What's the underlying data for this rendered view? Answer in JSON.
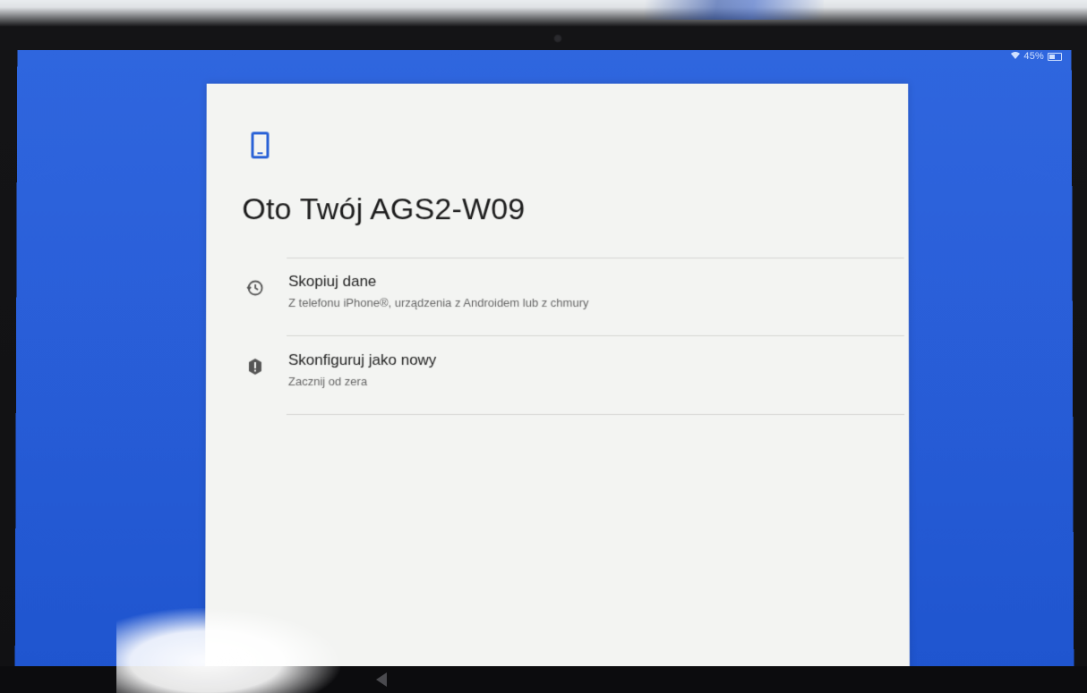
{
  "status_bar": {
    "battery_text": "45%",
    "wifi_icon": "wifi-icon",
    "battery_icon": "battery-icon"
  },
  "setup": {
    "device_icon": "phone-icon",
    "title": "Oto Twój AGS2-W09",
    "options": [
      {
        "icon": "history-icon",
        "label": "Skopiuj dane",
        "subtitle": "Z telefonu iPhone®, urządzenia z Androidem lub z chmury"
      },
      {
        "icon": "new-device-icon",
        "label": "Skonfiguruj jako nowy",
        "subtitle": "Zacznij od zera"
      }
    ]
  },
  "nav": {
    "back_icon": "back-icon"
  },
  "colors": {
    "background_blue": "#2a5fd9",
    "accent": "#2a62d6",
    "card": "#f3f4f2"
  }
}
